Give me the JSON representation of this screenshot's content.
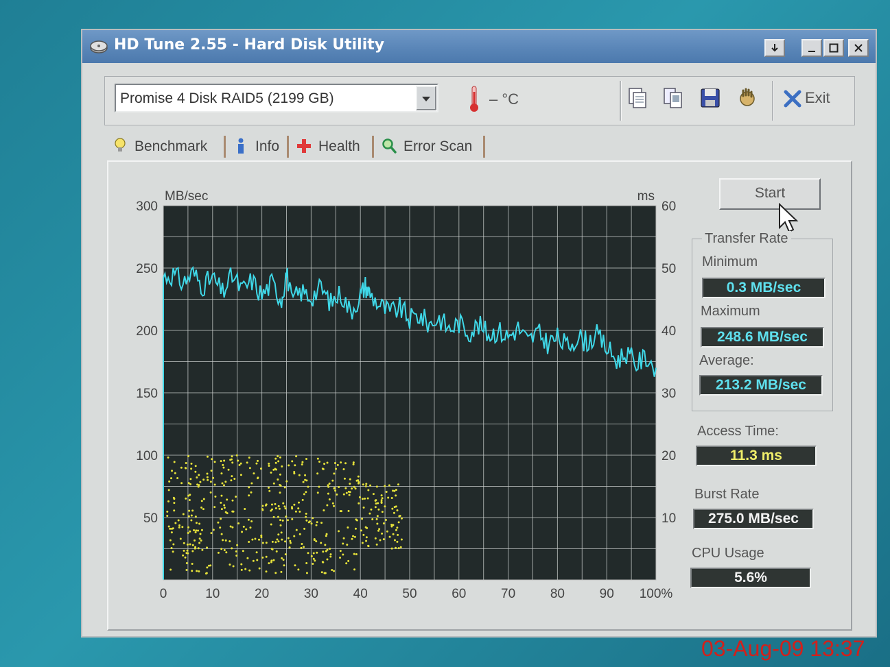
{
  "window": {
    "title": "HD Tune 2.55 - Hard Disk Utility"
  },
  "toolbar": {
    "drive": "Promise  4 Disk RAID5   (2199 GB)",
    "temperature": "– °C",
    "exit_label": "Exit"
  },
  "tabs": [
    {
      "label": "Benchmark",
      "icon": "bulb-icon"
    },
    {
      "label": "Info",
      "icon": "info-icon"
    },
    {
      "label": "Health",
      "icon": "health-cross-icon"
    },
    {
      "label": "Error Scan",
      "icon": "magnifier-icon"
    }
  ],
  "side": {
    "start_label": "Start",
    "transfer_rate_label": "Transfer Rate",
    "minimum_label": "Minimum",
    "minimum_value": "0.3 MB/sec",
    "maximum_label": "Maximum",
    "maximum_value": "248.6 MB/sec",
    "average_label": "Average:",
    "average_value": "213.2 MB/sec",
    "access_time_label": "Access Time:",
    "access_time_value": "11.3 ms",
    "burst_rate_label": "Burst Rate",
    "burst_rate_value": "275.0 MB/sec",
    "cpu_usage_label": "CPU Usage",
    "cpu_usage_value": "5.6%"
  },
  "colors": {
    "transfer_line": "#3fd8e8",
    "access_points": "#e6e23a",
    "plot_bg": "#222a2a",
    "grid": "#c9cdcc",
    "value_cyan": "#5fe0ee",
    "value_yellow": "#f0ee6a",
    "value_white": "#f2f2f2",
    "timestamp": "#d3201b"
  },
  "timestamp": "03-Aug-09 13:37",
  "chart_data": {
    "type": "line",
    "ylabel_left": "MB/sec",
    "ylabel_right": "ms",
    "xlim": [
      0,
      100
    ],
    "ylim_left": [
      0,
      300
    ],
    "ylim_right": [
      0,
      60
    ],
    "x_ticks": [
      "0",
      "10",
      "20",
      "30",
      "40",
      "50",
      "60",
      "70",
      "80",
      "90",
      "100%"
    ],
    "y_ticks_left": [
      "300",
      "250",
      "200",
      "150",
      "100",
      "50"
    ],
    "y_ticks_right": [
      "60",
      "50",
      "40",
      "30",
      "20",
      "10"
    ],
    "grid": true,
    "series": [
      {
        "name": "Transfer Rate",
        "axis": "left",
        "x": [
          0,
          2,
          4,
          6,
          8,
          10,
          12,
          14,
          16,
          18,
          20,
          22,
          24,
          25,
          26,
          28,
          30,
          32,
          34,
          36,
          38,
          40,
          41,
          42,
          44,
          46,
          48,
          50,
          52,
          54,
          56,
          58,
          60,
          62,
          64,
          66,
          68,
          70,
          72,
          74,
          76,
          78,
          80,
          82,
          84,
          86,
          88,
          90,
          92,
          94,
          96,
          98,
          100
        ],
        "y": [
          243,
          245,
          238,
          246,
          236,
          242,
          230,
          244,
          232,
          240,
          228,
          238,
          225,
          247,
          224,
          231,
          227,
          234,
          222,
          230,
          215,
          228,
          236,
          229,
          220,
          214,
          218,
          209,
          212,
          205,
          210,
          201,
          206,
          199,
          204,
          197,
          200,
          195,
          202,
          191,
          198,
          190,
          194,
          187,
          195,
          191,
          196,
          186,
          176,
          182,
          173,
          179,
          170
        ]
      },
      {
        "name": "Access Time",
        "axis": "right",
        "type": "scatter",
        "x_range": [
          0,
          48
        ],
        "y_range_ms": [
          1,
          20
        ]
      }
    ]
  }
}
